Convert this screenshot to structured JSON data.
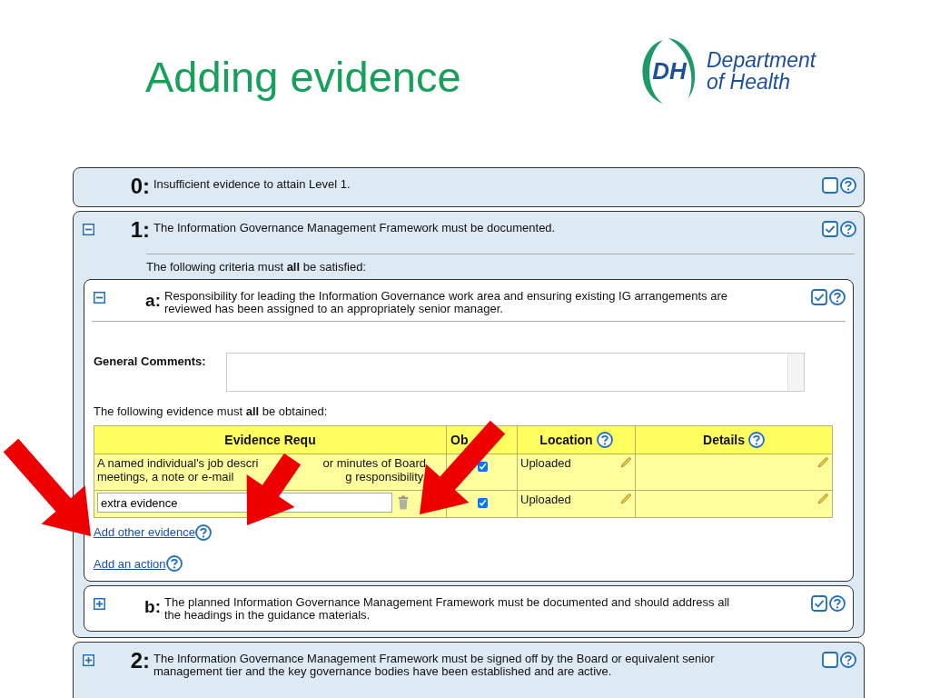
{
  "slide_title": "Adding evidence",
  "logo": {
    "mark": "DH",
    "name_lines": [
      "Department",
      "of Health"
    ]
  },
  "levels": [
    {
      "kind": "plain",
      "number": "0:",
      "text": "Insufficient evidence to attain Level 1.",
      "checked": false
    },
    {
      "kind": "expandable",
      "expanded": true,
      "number": "1:",
      "text": "The Information Governance Management Framework must be documented.",
      "checked": true,
      "criteria_note": "The following criteria must **all** be satisfied:",
      "criteria": [
        {
          "expanded": true,
          "letter": "a:",
          "text": "Responsibility for leading the Information Governance work area and ensuring existing IG arrangements are reviewed has been assigned to an appropriately senior manager.",
          "checked": true,
          "comments_label": "General Comments:",
          "evidence_note": "The following evidence must **all** be obtained:",
          "columns": [
            {
              "label": "Evidence Requ",
              "help": false
            },
            {
              "label": "Ob",
              "help": false
            },
            {
              "label": "Location",
              "help": true
            },
            {
              "label": "Details",
              "help": true
            }
          ],
          "rows": [
            {
              "kind": "text",
              "evidence_lines": [
                [
                  "A named individual's job descri",
                  "or minutes of Board"
                ],
                [
                  "meetings, a note or e-mail",
                  "g responsibility."
                ]
              ],
              "obtained": true,
              "location": "Uploaded"
            },
            {
              "kind": "input",
              "value": "extra evidence",
              "obtained": true,
              "location": "Uploaded"
            }
          ],
          "links": [
            "Add other evidence",
            "Add an action"
          ]
        },
        {
          "expanded": false,
          "letter": "b:",
          "text": "The planned Information Governance Management Framework must be documented and should address all the headings in the guidance materials.",
          "checked": true
        }
      ]
    },
    {
      "kind": "expandable",
      "expanded": false,
      "number": "2:",
      "text": "The Information Governance Management Framework must be signed off by the Board or equivalent senior management tier and the key governance bodies have been established and are active.",
      "checked": false
    }
  ]
}
